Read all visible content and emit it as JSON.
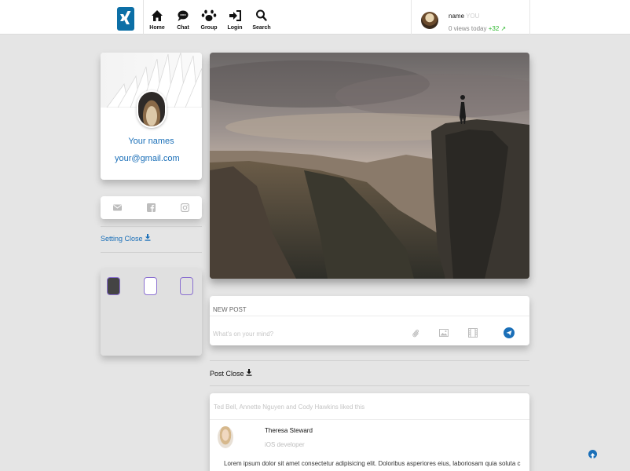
{
  "nav": {
    "items": [
      {
        "label": "Home",
        "icon": "home-icon"
      },
      {
        "label": "Chat",
        "icon": "chat-icon"
      },
      {
        "label": "Group",
        "icon": "group-icon"
      },
      {
        "label": "Login",
        "icon": "login-icon"
      },
      {
        "label": "Search",
        "icon": "search-icon"
      }
    ]
  },
  "user": {
    "name": "name",
    "you": "YOU",
    "views": "0 views today",
    "views_delta": "+32"
  },
  "profile": {
    "name": "Your names",
    "email": "your@gmail.com"
  },
  "social": [
    "envelope-icon",
    "facebook-icon",
    "instagram-icon"
  ],
  "sidebar": {
    "setting_close": "Setting Close"
  },
  "themes": {
    "swatches": [
      "#444444",
      "#ffffff",
      "#e0e0e0"
    ]
  },
  "new_post": {
    "title": "NEW POST",
    "placeholder": "What's on your mind?"
  },
  "feed": {
    "post_close": "Post Close",
    "liked_by": "Ted Bell, Annette Nguyen and Cody Hawkins liked this",
    "author": "Theresa Steward",
    "role": "iOS developer",
    "body": "Lorem ipsum dolor sit amet consectetur adipisicing elit. Doloribus asperiores eius, laboriosam quia soluta culpa sit ipsam"
  },
  "colors": {
    "accent": "#1a6fb8",
    "logo": "#0c6fa6",
    "positive": "#2eb82e",
    "swatch_border": "#8a6fd0"
  }
}
